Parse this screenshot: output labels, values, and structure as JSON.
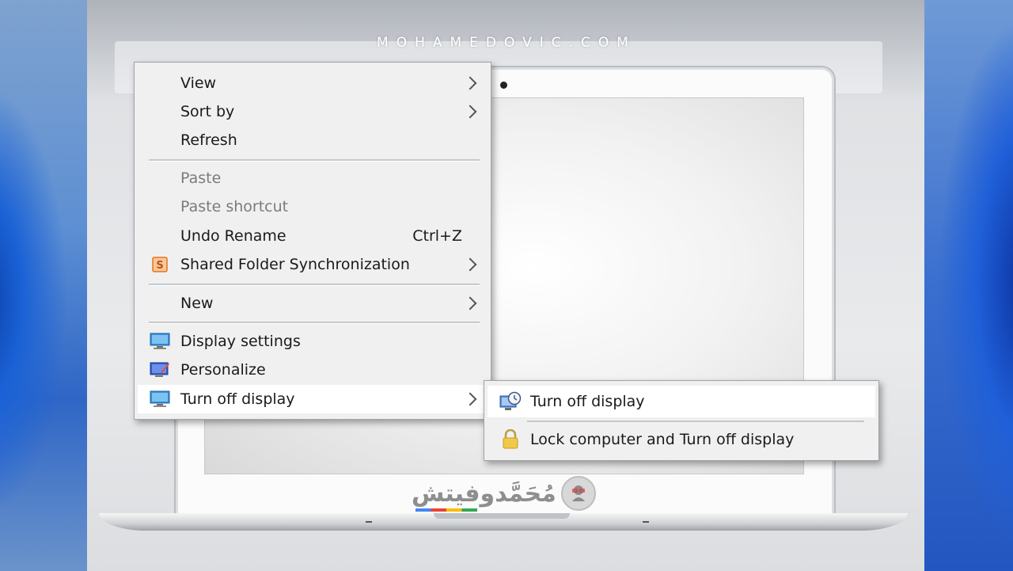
{
  "watermark": "MOHAMEDOVIC.COM",
  "brand": {
    "arabic_text": "مُحَمَّدوفيتش"
  },
  "context_menu": {
    "items": [
      {
        "label": "View",
        "has_submenu": true
      },
      {
        "label": "Sort by",
        "has_submenu": true
      },
      {
        "label": "Refresh"
      },
      {
        "label": "Paste",
        "disabled": true
      },
      {
        "label": "Paste shortcut",
        "disabled": true
      },
      {
        "label": "Undo Rename",
        "shortcut": "Ctrl+Z"
      },
      {
        "label": "Shared Folder Synchronization",
        "icon": "shared-folder-sync-icon",
        "has_submenu": true
      },
      {
        "label": "New",
        "has_submenu": true
      },
      {
        "label": "Display settings",
        "icon": "monitor-icon"
      },
      {
        "label": "Personalize",
        "icon": "personalize-icon"
      },
      {
        "label": "Turn off display",
        "icon": "monitor-icon",
        "has_submenu": true,
        "highlighted": true
      }
    ]
  },
  "submenu": {
    "items": [
      {
        "label": "Turn off display",
        "icon": "clock-monitor-icon",
        "highlighted": true
      },
      {
        "label": "Lock computer and Turn off display",
        "icon": "padlock-icon"
      }
    ]
  },
  "colors": {
    "menu_bg": "#f0f0f0",
    "highlight": "#ffffff",
    "disabled_text": "#7b7b7b",
    "sync_icon": "#e8731a"
  }
}
